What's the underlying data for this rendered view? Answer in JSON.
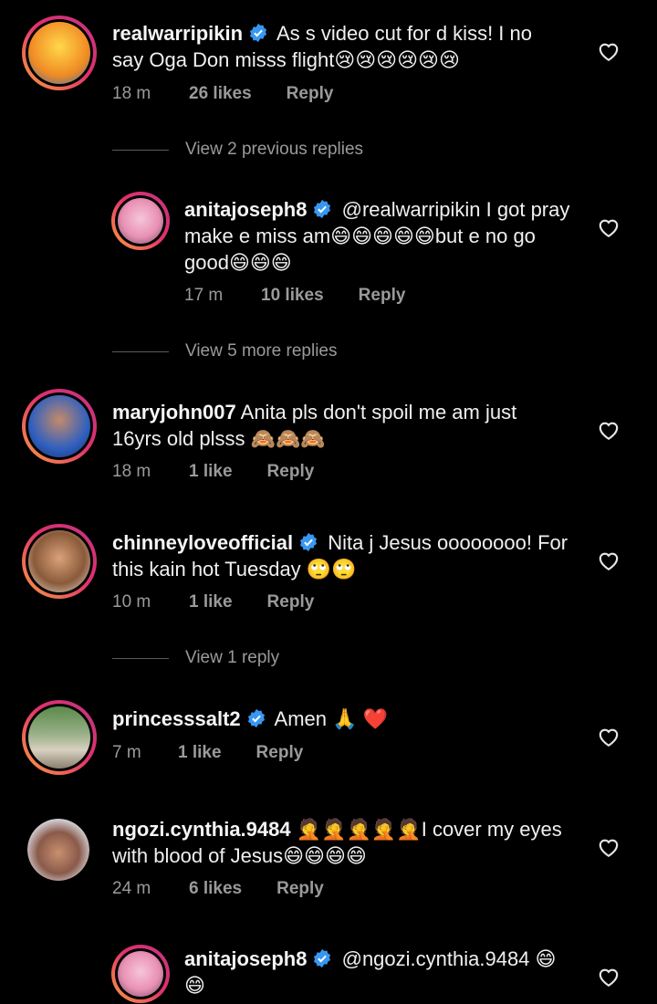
{
  "comments": [
    {
      "username": "realwarripikin",
      "verified": true,
      "text": "As s video cut for d kiss! I no say Oga Don misss flight😢😢😢😢😢😢",
      "time": "18 m",
      "likes": "26 likes",
      "reply": "Reply"
    },
    {
      "view": "View 2 previous replies"
    },
    {
      "username": "anitajoseph8",
      "verified": true,
      "text": "@realwarripikin I got pray make e miss am😄😄😄😄😄but e no go good😄😄😄",
      "time": "17 m",
      "likes": "10 likes",
      "reply": "Reply"
    },
    {
      "view": "View 5 more replies"
    },
    {
      "username": "maryjohn007",
      "verified": false,
      "text": "Anita pls don't spoil me am just 16yrs old plsss 🙈🙈🙈",
      "time": "18 m",
      "likes": "1 like",
      "reply": "Reply"
    },
    {
      "username": "chinneyloveofficial",
      "verified": true,
      "text": "Nita j Jesus oooooooo! For this kain hot Tuesday 🙄🙄",
      "time": "10 m",
      "likes": "1 like",
      "reply": "Reply"
    },
    {
      "view": "View 1 reply"
    },
    {
      "username": "princesssalt2",
      "verified": true,
      "text": "Amen 🙏 ❤️",
      "time": "7 m",
      "likes": "1 like",
      "reply": "Reply"
    },
    {
      "username": "ngozi.cynthia.9484",
      "verified": false,
      "text": "🤦🤦🤦🤦🤦I cover my eyes with blood of Jesus😄😄😄😄",
      "time": "24 m",
      "likes": "6 likes",
      "reply": "Reply"
    },
    {
      "username": "anitajoseph8",
      "verified": true,
      "text": "@ngozi.cynthia.9484 😄😄",
      "time": "",
      "likes": "",
      "reply": ""
    }
  ],
  "colors": {
    "background": "#000000",
    "verified": "#3897f0",
    "secondary_text": "#9a9a9a"
  },
  "icons": {
    "heart": "heart-outline-icon",
    "verified": "verified-badge-icon"
  }
}
